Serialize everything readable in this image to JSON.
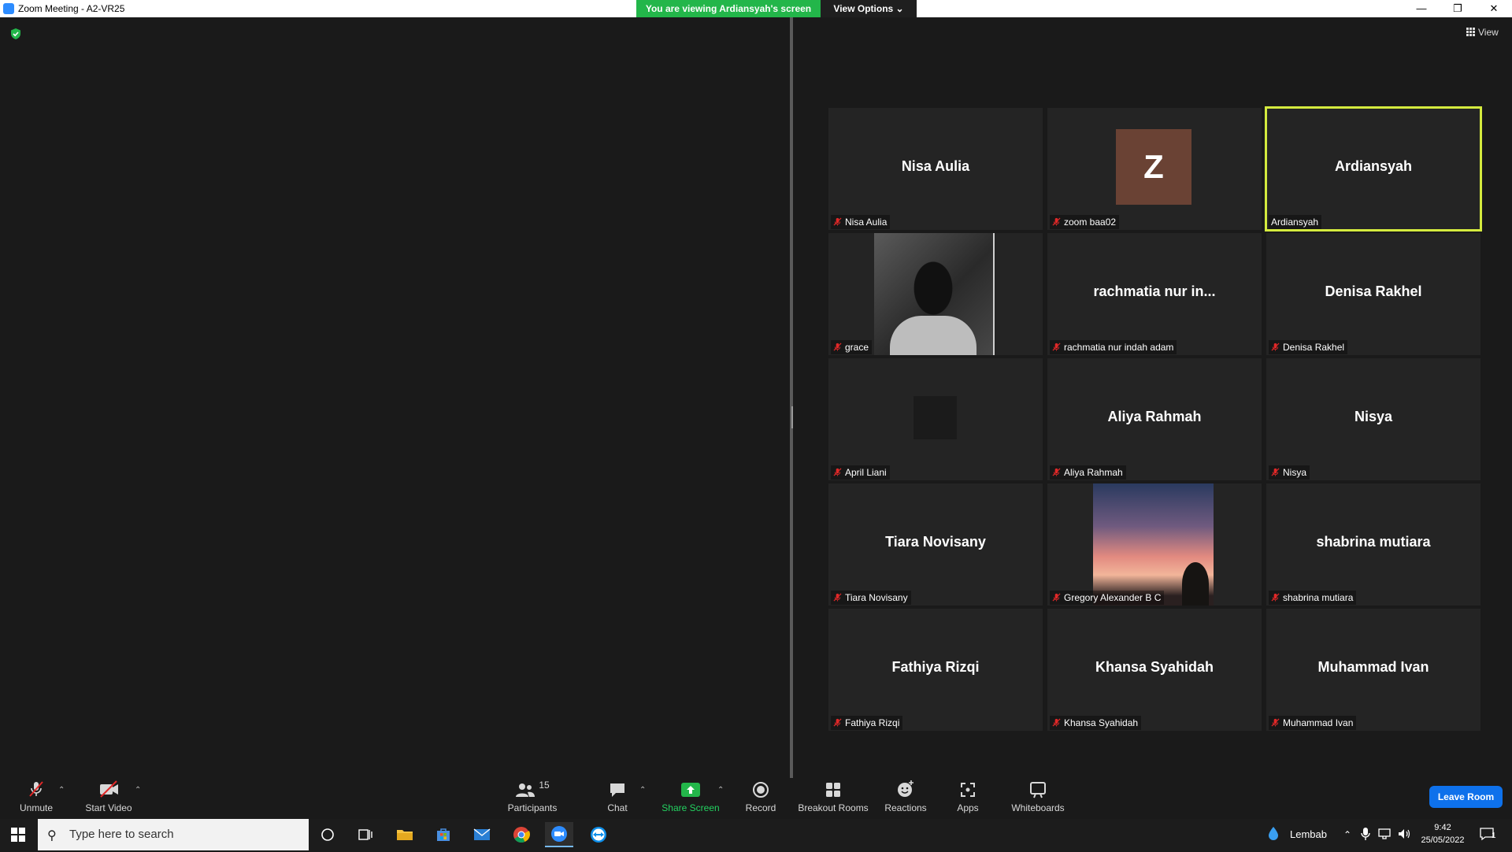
{
  "window": {
    "title": "Zoom Meeting - A2-VR25",
    "minimize": "—",
    "restore": "❐",
    "close": "✕"
  },
  "banner": {
    "viewing": "You are viewing Ardiansyah's screen",
    "view_options": "View Options ⌄"
  },
  "view_button": "View",
  "tiles": [
    {
      "center": "Nisa Aulia",
      "tag": "Nisa Aulia",
      "muted": true,
      "kind": "name"
    },
    {
      "center": "Z",
      "tag": "zoom baa02",
      "muted": true,
      "kind": "avatar"
    },
    {
      "center": "Ardiansyah",
      "tag": "Ardiansyah",
      "muted": false,
      "kind": "name",
      "active": true
    },
    {
      "center": "",
      "tag": "grace",
      "muted": true,
      "kind": "photo"
    },
    {
      "center": "rachmatia nur in...",
      "tag": "rachmatia nur indah adam",
      "muted": true,
      "kind": "name"
    },
    {
      "center": "Denisa Rakhel",
      "tag": "Denisa Rakhel",
      "muted": true,
      "kind": "name"
    },
    {
      "center": "",
      "tag": "April Liani",
      "muted": true,
      "kind": "blank"
    },
    {
      "center": "Aliya Rahmah",
      "tag": "Aliya Rahmah",
      "muted": true,
      "kind": "name"
    },
    {
      "center": "Nisya",
      "tag": "Nisya",
      "muted": true,
      "kind": "name"
    },
    {
      "center": "Tiara Novisany",
      "tag": "Tiara Novisany",
      "muted": true,
      "kind": "name"
    },
    {
      "center": "",
      "tag": "Gregory Alexander B C",
      "muted": true,
      "kind": "photo"
    },
    {
      "center": "shabrina mutiara",
      "tag": "shabrina mutiara",
      "muted": true,
      "kind": "name"
    },
    {
      "center": "Fathiya Rizqi",
      "tag": "Fathiya Rizqi",
      "muted": true,
      "kind": "name"
    },
    {
      "center": "Khansa Syahidah",
      "tag": "Khansa Syahidah",
      "muted": true,
      "kind": "name"
    },
    {
      "center": "Muhammad Ivan",
      "tag": "Muhammad Ivan",
      "muted": true,
      "kind": "name"
    }
  ],
  "toolbar": {
    "unmute": "Unmute",
    "start_video": "Start Video",
    "participants": "Participants",
    "participants_count": "15",
    "chat": "Chat",
    "share_screen": "Share Screen",
    "record": "Record",
    "breakout_rooms": "Breakout Rooms",
    "reactions": "Reactions",
    "apps": "Apps",
    "whiteboards": "Whiteboards",
    "leave": "Leave Room",
    "caret": "⌃"
  },
  "taskbar": {
    "search_placeholder": "Type here to search",
    "weather": "Lembab",
    "time": "9:42",
    "date": "25/05/2022",
    "notifications": "1"
  },
  "colors": {
    "accent_green": "#23b64a",
    "active_speaker": "#d4ea3e",
    "leave_blue": "#0e71eb",
    "muted_red": "#e02828"
  }
}
